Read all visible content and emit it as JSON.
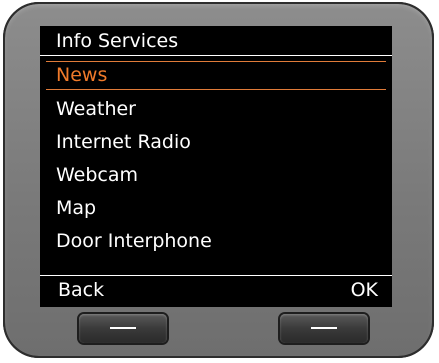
{
  "screen": {
    "title": "Info Services",
    "menu_items": [
      {
        "label": "News",
        "selected": true
      },
      {
        "label": "Weather"
      },
      {
        "label": "Internet Radio"
      },
      {
        "label": "Webcam"
      },
      {
        "label": "Map"
      },
      {
        "label": "Door Interphone"
      }
    ],
    "softkeys": {
      "left_label": "Back",
      "right_label": "OK"
    }
  },
  "colors": {
    "selection": "#f07a2a",
    "screen_background": "#000000",
    "text": "#ffffff",
    "device_body": "#7a7a7a"
  },
  "icons": {
    "left_hardware_key": "minus-icon",
    "right_hardware_key": "minus-icon"
  }
}
